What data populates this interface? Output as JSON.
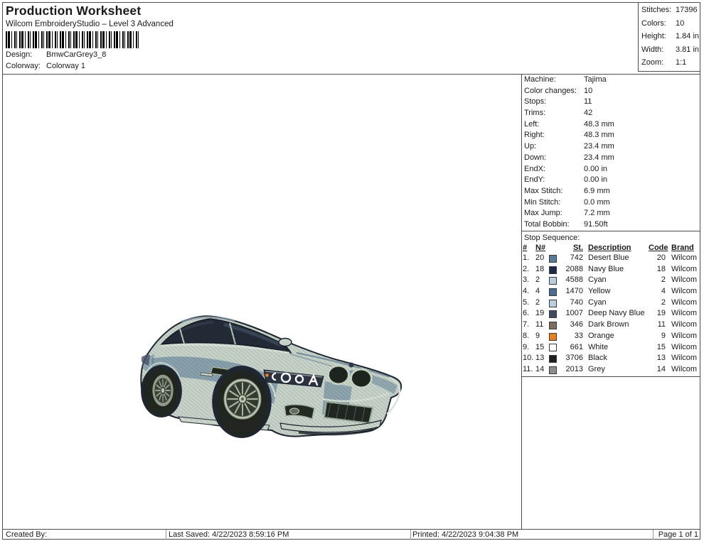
{
  "header": {
    "title": "Production Worksheet",
    "subtitle": "Wilcom EmbroideryStudio – Level 3 Advanced",
    "design_label": "Design:",
    "design_value": "BmwCarGrey3_8",
    "colorway_label": "Colorway:",
    "colorway_value": "Colorway 1"
  },
  "summary": {
    "rows": [
      {
        "label": "Stitches:",
        "value": "17396"
      },
      {
        "label": "Colors:",
        "value": "10"
      },
      {
        "label": "Height:",
        "value": "1.84 in"
      },
      {
        "label": "Width:",
        "value": "3.81 in"
      },
      {
        "label": "Zoom:",
        "value": "1:1"
      }
    ]
  },
  "machine_info": {
    "rows": [
      {
        "label": "Machine:",
        "value": "Tajima"
      },
      {
        "label": "Color changes:",
        "value": "10"
      },
      {
        "label": "Stops:",
        "value": "11"
      },
      {
        "label": "Trims:",
        "value": "42"
      },
      {
        "label": "Left:",
        "value": "48.3 mm"
      },
      {
        "label": "Right:",
        "value": "48.3 mm"
      },
      {
        "label": "Up:",
        "value": "23.4 mm"
      },
      {
        "label": "Down:",
        "value": "23.4 mm"
      },
      {
        "label": "EndX:",
        "value": "0.00 in"
      },
      {
        "label": "EndY:",
        "value": "0.00 in"
      },
      {
        "label": "Max Stitch:",
        "value": "6.9 mm"
      },
      {
        "label": "Min Stitch:",
        "value": "0.0 mm"
      },
      {
        "label": "Max Jump:",
        "value": "7.2 mm"
      },
      {
        "label": "Total Bobbin:",
        "value": "91.50ft"
      }
    ]
  },
  "stop_sequence": {
    "title": "Stop Sequence:",
    "columns": [
      "#",
      "N#",
      "St.",
      "Description",
      "Code",
      "Brand"
    ],
    "rows": [
      {
        "num": "1.",
        "n": "20",
        "color": "#5a7a99",
        "st": "742",
        "description": "Desert Blue",
        "code": "20",
        "brand": "Wilcom"
      },
      {
        "num": "2.",
        "n": "18",
        "color": "#1c2b45",
        "st": "2088",
        "description": "Navy Blue",
        "code": "18",
        "brand": "Wilcom"
      },
      {
        "num": "3.",
        "n": "2",
        "color": "#b9cedf",
        "st": "4588",
        "description": "Cyan",
        "code": "2",
        "brand": "Wilcom"
      },
      {
        "num": "4.",
        "n": "4",
        "color": "#4a6d92",
        "st": "1470",
        "description": "Yellow",
        "code": "4",
        "brand": "Wilcom"
      },
      {
        "num": "5.",
        "n": "2",
        "color": "#b9cedf",
        "st": "740",
        "description": "Cyan",
        "code": "2",
        "brand": "Wilcom"
      },
      {
        "num": "6.",
        "n": "19",
        "color": "#3f4a63",
        "st": "1007",
        "description": "Deep Navy Blue",
        "code": "19",
        "brand": "Wilcom"
      },
      {
        "num": "7.",
        "n": "11",
        "color": "#7d6d60",
        "st": "346",
        "description": "Dark Brown",
        "code": "11",
        "brand": "Wilcom"
      },
      {
        "num": "8.",
        "n": "9",
        "color": "#e8821e",
        "st": "33",
        "description": "Orange",
        "code": "9",
        "brand": "Wilcom"
      },
      {
        "num": "9.",
        "n": "15",
        "color": "#ffffff",
        "st": "661",
        "description": "White",
        "code": "15",
        "brand": "Wilcom"
      },
      {
        "num": "10.",
        "n": "13",
        "color": "#21201a",
        "st": "3706",
        "description": "Black",
        "code": "13",
        "brand": "Wilcom"
      },
      {
        "num": "11.",
        "n": "14",
        "color": "#8d8d8d",
        "st": "2013",
        "description": "Grey",
        "code": "14",
        "brand": "Wilcom"
      }
    ]
  },
  "footer": {
    "created_by": "Created By:",
    "last_saved": "Last Saved: 4/22/2023 8:59:16 PM",
    "printed": "Printed: 4/22/2023 9:04:38 PM",
    "page": "Page 1 of 1"
  }
}
